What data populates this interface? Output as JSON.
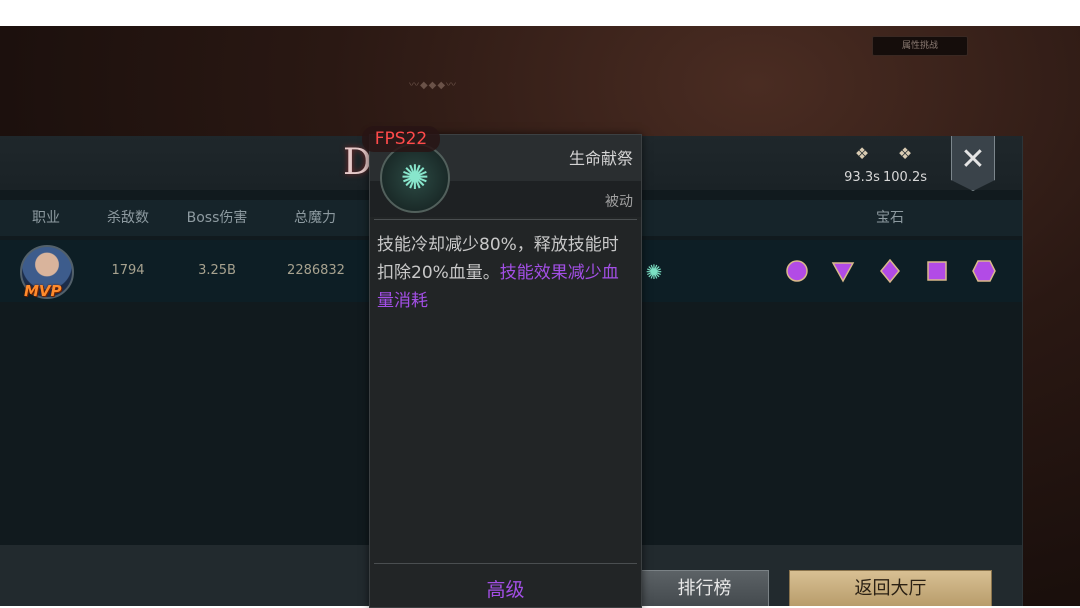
{
  "top_badge": "属性挑战",
  "title_partial": "D",
  "timers": [
    {
      "icon": "skull-crest-icon",
      "value": "93.3s"
    },
    {
      "icon": "skull-crest-icon",
      "value": "100.2s"
    }
  ],
  "close_label": "✕",
  "columns": [
    "职业",
    "杀敌数",
    "Boss伤害",
    "总魔力",
    "宝石"
  ],
  "row": {
    "mvp_label": "MVP",
    "kills": "1794",
    "boss_damage": "3.25B",
    "total_mana": "2286832"
  },
  "gems": [
    {
      "shape": "circle",
      "color": "#b24be6"
    },
    {
      "shape": "triangle",
      "color": "#b24be6"
    },
    {
      "shape": "diamond",
      "color": "#b24be6"
    },
    {
      "shape": "square",
      "color": "#b24be6"
    },
    {
      "shape": "hexagon",
      "color": "#b24be6"
    }
  ],
  "buttons": {
    "rank": "排行榜",
    "lobby": "返回大厅"
  },
  "tooltip": {
    "name": "生命献祭",
    "type": "被动",
    "desc_main": "技能冷却减少80%，释放技能时扣除20%血量。",
    "desc_highlight": "技能效果减少血量消耗",
    "level": "高级"
  },
  "fps": "FPS22",
  "colors": {
    "accent_purple": "#a34fe6",
    "fps_red": "#ff4a4a",
    "lobby_gold": "#d8c093"
  }
}
